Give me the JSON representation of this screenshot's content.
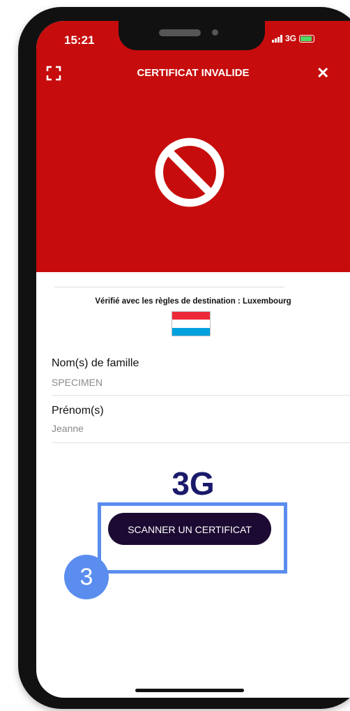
{
  "status_bar": {
    "time": "15:21",
    "network": "3G"
  },
  "header": {
    "title": "CERTIFICAT INVALIDE"
  },
  "verification": {
    "text": "Vérifié avec les règles de destination : Luxembourg",
    "flag_colors": [
      "#ed2939",
      "#ffffff",
      "#00a1de"
    ]
  },
  "fields": [
    {
      "label": "Nom(s) de famille",
      "value": "SPECIMEN"
    },
    {
      "label": "Prénom(s)",
      "value": "Jeanne"
    }
  ],
  "network_annotation": "3G",
  "scan_button": {
    "label": "SCANNER UN CERTIFICAT"
  },
  "step_badge": "3",
  "colors": {
    "header_red": "#c60c0c",
    "button_dark": "#1c0a33",
    "highlight_blue": "#5b8def"
  }
}
